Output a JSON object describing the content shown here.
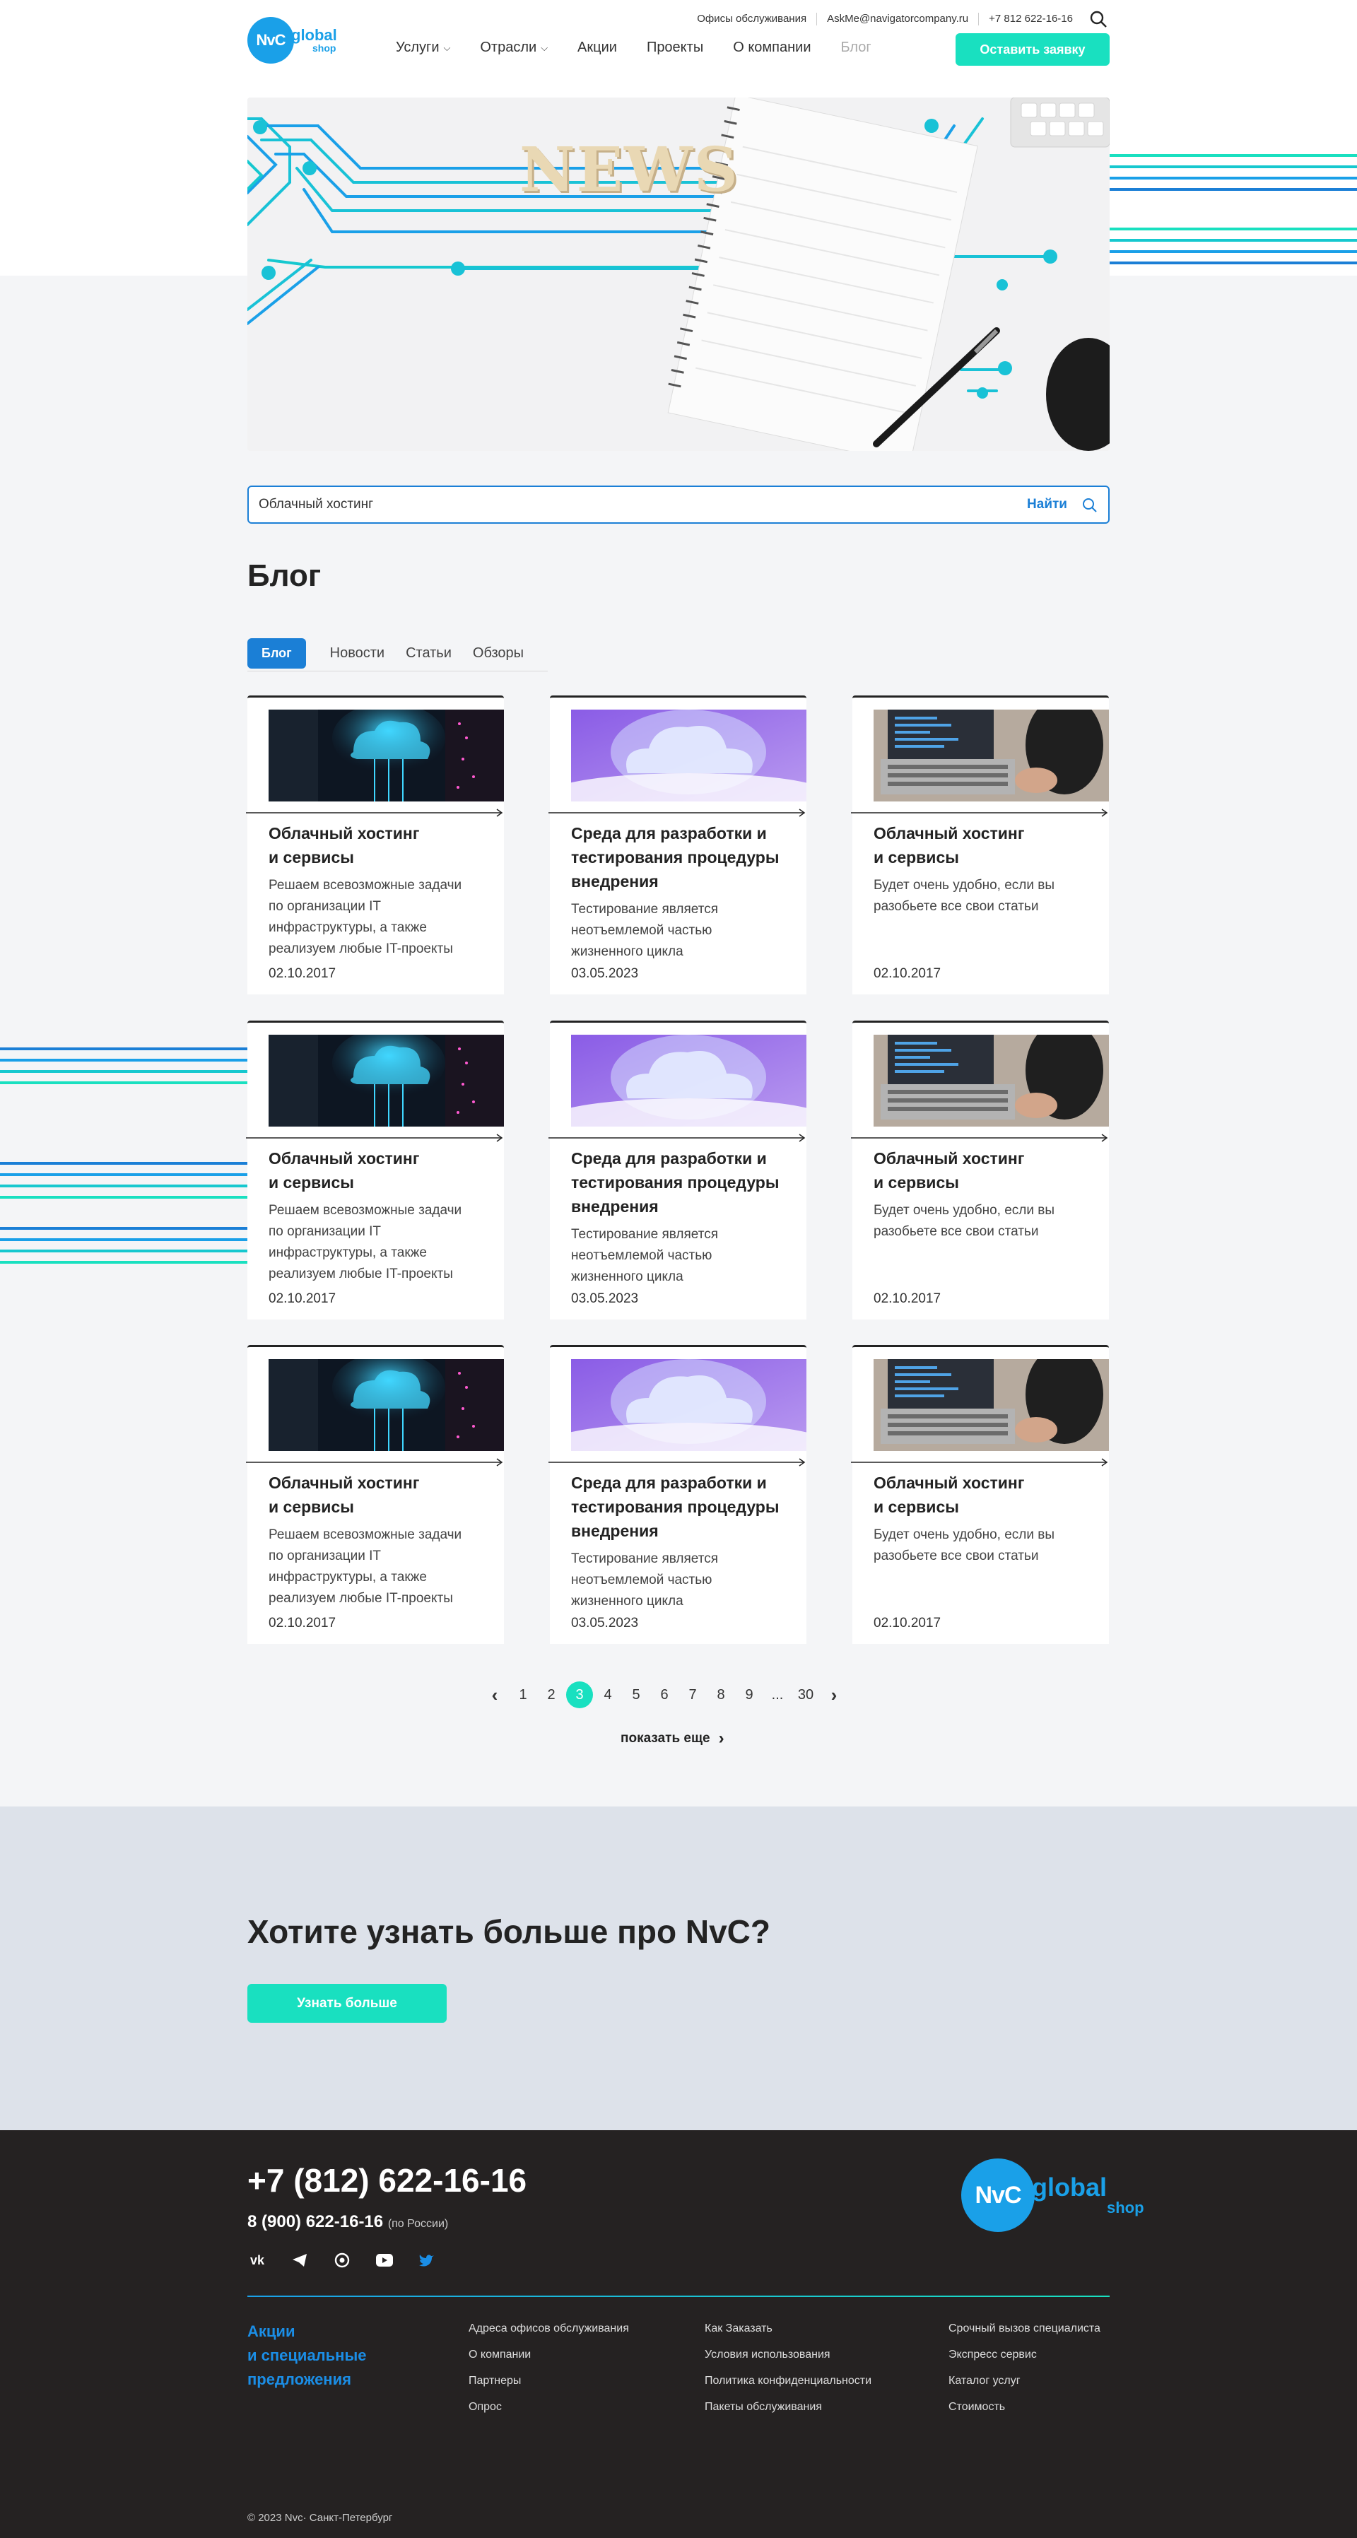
{
  "header": {
    "logo": {
      "mark": "NvC",
      "word": "global",
      "sub": "shop"
    },
    "util_links": [
      "Офисы обслуживания",
      "AskMe@navigatorcompany.ru",
      "+7 812 622-16-16"
    ],
    "nav": [
      {
        "label": "Услуги",
        "dropdown": true
      },
      {
        "label": "Отрасли",
        "dropdown": true
      },
      {
        "label": "Акции",
        "dropdown": false
      },
      {
        "label": "Проекты",
        "dropdown": false
      },
      {
        "label": "О компании",
        "dropdown": false
      },
      {
        "label": "Блог",
        "dropdown": false,
        "muted": true
      }
    ],
    "cta": "Оставить заявку"
  },
  "hero": {
    "word": "NEWS"
  },
  "search": {
    "value": "Облачный хостинг",
    "button": "Найти"
  },
  "page_title": "Блог",
  "tabs": [
    {
      "label": "Блог",
      "active": true
    },
    {
      "label": "Новости",
      "active": false
    },
    {
      "label": "Статьи",
      "active": false
    },
    {
      "label": "Обзоры",
      "active": false
    }
  ],
  "cards": [
    {
      "kind": "server",
      "title_1": "Облачный хостинг",
      "title_2": "и сервисы",
      "title_3": "",
      "desc": [
        "Решаем всевозможные задачи",
        "по организации IT",
        "инфраструктуры, а также",
        "реализуем любые IT-проекты"
      ],
      "date": "02.10.2017"
    },
    {
      "kind": "cloud",
      "title_1": "Среда для разработки и",
      "title_2": "тестирования процедуры",
      "title_3": "внедрения",
      "desc": [
        "Тестирование является",
        "неотъемлемой частью",
        "жизненного цикла"
      ],
      "date": "03.05.2023"
    },
    {
      "kind": "laptop",
      "title_1": "Облачный хостинг",
      "title_2": "и сервисы",
      "title_3": "",
      "desc": [
        "Будет очень удобно, если вы",
        "разобьете все свои статьи"
      ],
      "date": "02.10.2017"
    },
    {
      "kind": "server",
      "title_1": "Облачный хостинг",
      "title_2": "и сервисы",
      "title_3": "",
      "desc": [
        "Решаем всевозможные задачи",
        "по организации IT",
        "инфраструктуры, а также",
        "реализуем любые IT-проекты"
      ],
      "date": "02.10.2017"
    },
    {
      "kind": "cloud",
      "title_1": "Среда для разработки и",
      "title_2": "тестирования процедуры",
      "title_3": "внедрения",
      "desc": [
        "Тестирование является",
        "неотъемлемой частью",
        "жизненного цикла"
      ],
      "date": "03.05.2023"
    },
    {
      "kind": "laptop",
      "title_1": "Облачный хостинг",
      "title_2": "и сервисы",
      "title_3": "",
      "desc": [
        "Будет очень удобно, если вы",
        "разобьете все свои статьи"
      ],
      "date": "02.10.2017"
    },
    {
      "kind": "server",
      "title_1": "Облачный хостинг",
      "title_2": "и сервисы",
      "title_3": "",
      "desc": [
        "Решаем всевозможные задачи",
        "по организации IT",
        "инфраструктуры, а также",
        "реализуем любые IT-проекты"
      ],
      "date": "02.10.2017"
    },
    {
      "kind": "cloud",
      "title_1": "Среда для разработки и",
      "title_2": "тестирования процедуры",
      "title_3": "внедрения",
      "desc": [
        "Тестирование является",
        "неотъемлемой частью",
        "жизненного цикла"
      ],
      "date": "03.05.2023"
    },
    {
      "kind": "laptop",
      "title_1": "Облачный хостинг",
      "title_2": "и сервисы",
      "title_3": "",
      "desc": [
        "Будет очень удобно, если вы",
        "разобьете все свои статьи"
      ],
      "date": "02.10.2017"
    }
  ],
  "pagination": {
    "pages": [
      "1",
      "2",
      "3",
      "4",
      "5",
      "6",
      "7",
      "8",
      "9",
      "...",
      "30"
    ],
    "current": "3",
    "prev_icon": "chevron-left",
    "next_icon": "chevron-right"
  },
  "show_more": "показать еще",
  "cta_band": {
    "title": "Хотите узнать больше про NvC?",
    "button": "Узнать больше"
  },
  "footer": {
    "phone": "+7 (812) 622-16-16",
    "phone2": "8 (900) 622-16-16",
    "phone2_note": "(по России)",
    "socials": [
      "vk",
      "telegram",
      "whatsapp",
      "youtube",
      "twitter"
    ],
    "promo": [
      "Акции",
      "и специальные",
      "предложения"
    ],
    "col1": [
      "Адреса офисов обслуживания",
      "О компании",
      "Партнеры",
      "Опрос"
    ],
    "col2": [
      "Как Заказать",
      "Условия использования",
      "Политика конфиденциальности",
      "Пакеты обслуживания"
    ],
    "col3": [
      "Срочный вызов специалиста",
      "Экспресс сервис",
      "Каталог услуг",
      "Стоимость"
    ],
    "copyright": "© 2023 Nvc· Санкт-Петербург"
  },
  "colors": {
    "accent": "#19e0c0",
    "primary": "#1b7fd6",
    "logo": "#1aa0e8",
    "dark": "#252222",
    "band": "#dde2ea"
  }
}
